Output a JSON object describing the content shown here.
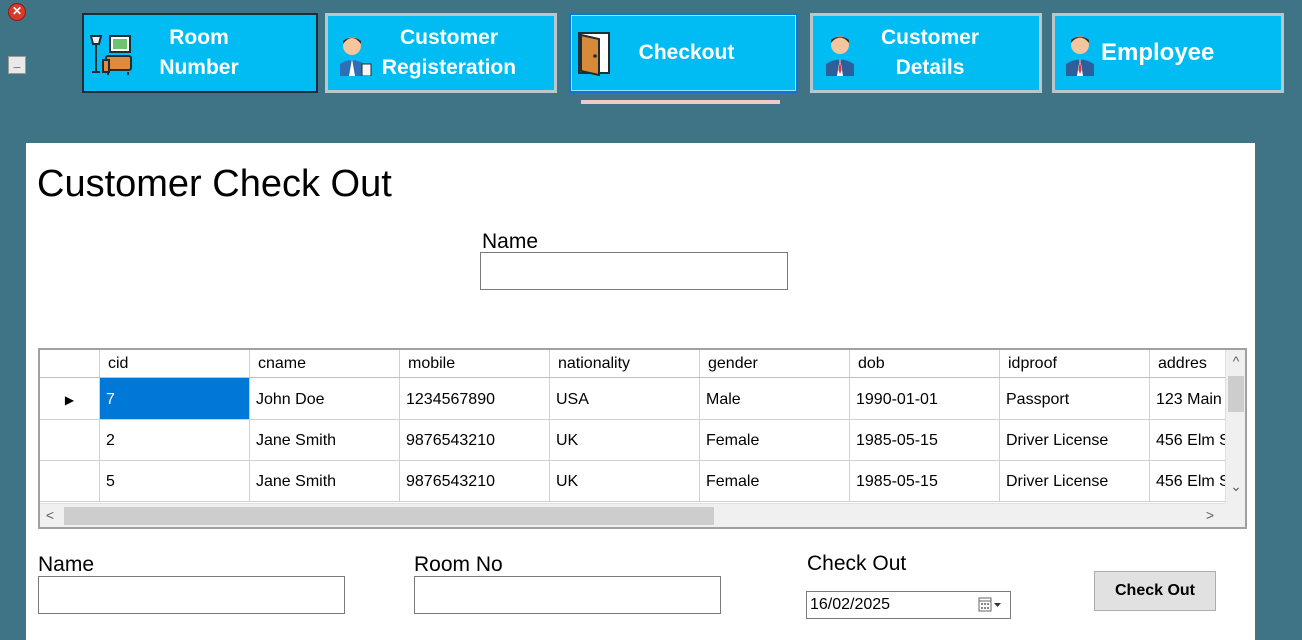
{
  "window": {
    "close_glyph": "✕",
    "minimize_glyph": "_"
  },
  "nav": {
    "room": {
      "line1": "Room",
      "line2": "Number"
    },
    "registration": {
      "line1": "Customer",
      "line2": "Registeration"
    },
    "checkout": {
      "label": "Checkout"
    },
    "details": {
      "line1": "Customer",
      "line2": "Details"
    },
    "employee": {
      "label": "Employee"
    }
  },
  "page": {
    "title": "Customer Check Out"
  },
  "search": {
    "label": "Name",
    "value": ""
  },
  "grid": {
    "columns": [
      "cid",
      "cname",
      "mobile",
      "nationality",
      "gender",
      "dob",
      "idproof",
      "addres"
    ],
    "rows": [
      {
        "marker": "▶",
        "cid": "7",
        "cname": "John Doe",
        "mobile": "1234567890",
        "nationality": "USA",
        "gender": "Male",
        "dob": "1990-01-01",
        "idproof": "Passport",
        "address": "123 Main"
      },
      {
        "marker": "",
        "cid": "2",
        "cname": "Jane Smith",
        "mobile": "9876543210",
        "nationality": "UK",
        "gender": "Female",
        "dob": "1985-05-15",
        "idproof": "Driver License",
        "address": "456 Elm S"
      },
      {
        "marker": "",
        "cid": "5",
        "cname": "Jane Smith",
        "mobile": "9876543210",
        "nationality": "UK",
        "gender": "Female",
        "dob": "1985-05-15",
        "idproof": "Driver License",
        "address": "456 Elm S"
      }
    ],
    "scroll_up": "^",
    "scroll_down": "⌄",
    "scroll_left": "<",
    "scroll_right": ">"
  },
  "form": {
    "name_label": "Name",
    "name_value": "",
    "room_label": "Room No",
    "room_value": "",
    "checkout_label": "Check Out",
    "checkout_date": "16/02/2025",
    "button_label": "Check Out"
  },
  "icons": {
    "close": "close-icon",
    "minimize": "minimize-icon",
    "room": "room-furniture-icon",
    "registration": "customer-registration-icon",
    "checkout": "door-icon",
    "details": "customer-icon",
    "employee": "employee-icon",
    "calendar": "calendar-icon"
  },
  "colors": {
    "background": "#3f7487",
    "nav_button": "#00bcf2",
    "selection": "#0078d7"
  }
}
